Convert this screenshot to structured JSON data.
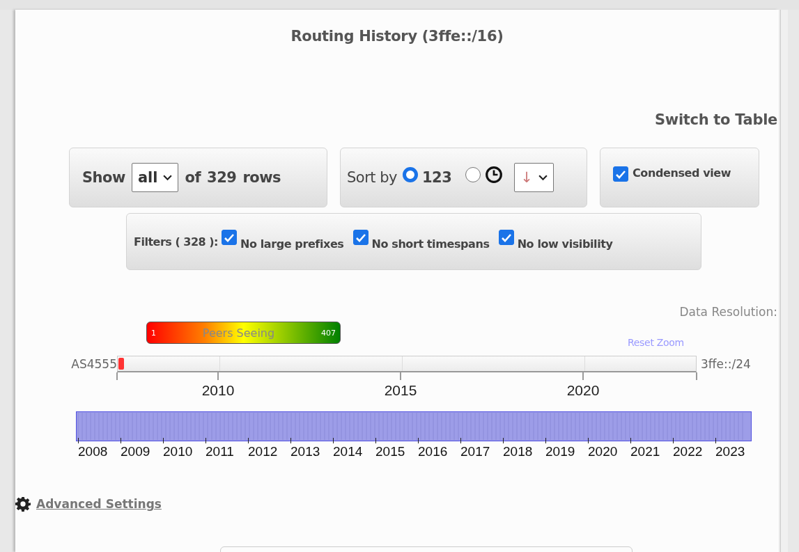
{
  "title": "Routing History (3ffe::/16)",
  "switch_link": "Switch to Table",
  "show": {
    "label": "Show",
    "value": "all",
    "of": "of",
    "count": "329",
    "rows": "rows"
  },
  "sort": {
    "label": "Sort by",
    "options": [
      {
        "kind": "number",
        "label": "123",
        "selected": true
      },
      {
        "kind": "time",
        "selected": false
      }
    ],
    "direction": "↓"
  },
  "condensed": {
    "label": "Condensed view",
    "checked": true
  },
  "filters": {
    "label": "Filters ( 328 ):",
    "items": [
      {
        "label": "No large prefixes",
        "checked": true
      },
      {
        "label": "No short timespans",
        "checked": true
      },
      {
        "label": "No low visibility",
        "checked": true
      }
    ]
  },
  "data_resolution": "Data Resolution:",
  "legend": {
    "title": "Peers Seeing",
    "min": "1",
    "max": "407"
  },
  "reset_zoom": "Reset Zoom",
  "timeline": {
    "rows": [
      {
        "label": "AS4555",
        "end_label": "3ffe::/24"
      }
    ],
    "ticks": [
      "2010",
      "2015",
      "2020"
    ]
  },
  "navigator": {
    "years": [
      "2008",
      "2009",
      "2010",
      "2011",
      "2012",
      "2013",
      "2014",
      "2015",
      "2016",
      "2017",
      "2018",
      "2019",
      "2020",
      "2021",
      "2022",
      "2023"
    ]
  },
  "advanced_settings": "Advanced Settings"
}
